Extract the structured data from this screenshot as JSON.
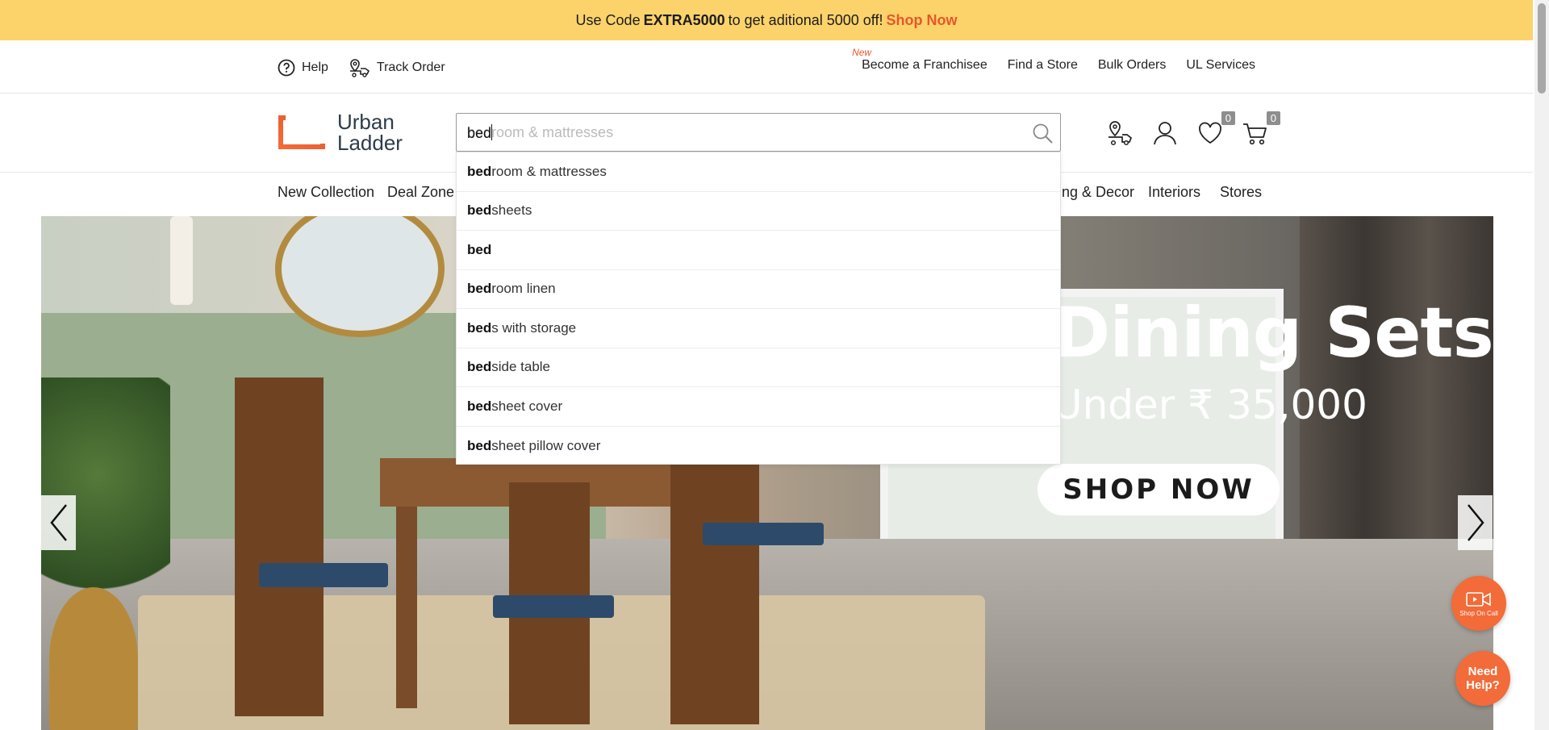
{
  "promo": {
    "prefix": "Use Code",
    "code": "EXTRA5000",
    "suffix": "to get aditional 5000 off!",
    "link": "Shop Now"
  },
  "utility": {
    "help": "Help",
    "track_order": "Track Order",
    "new_tag": "New",
    "links": [
      "Become a Franchisee",
      "Find a Store",
      "Bulk Orders",
      "UL Services"
    ]
  },
  "logo": {
    "line1": "Urban",
    "line2": "Ladder"
  },
  "search": {
    "typed": "bed",
    "ghost": "bedroom & mattresses"
  },
  "header_icons": {
    "wishlist_count": "0",
    "cart_count": "0"
  },
  "nav": {
    "items": [
      "New Collection",
      "Deal Zone",
      "ing & Decor",
      "Interiors",
      "Stores"
    ]
  },
  "suggestions": [
    {
      "match": "bed",
      "rest": "room & mattresses"
    },
    {
      "match": "bed",
      "rest": "sheets"
    },
    {
      "match": "bed",
      "rest": ""
    },
    {
      "match": "bed",
      "rest": "room linen"
    },
    {
      "match": "bed",
      "rest": "s with storage"
    },
    {
      "match": "bed",
      "rest": "side table"
    },
    {
      "match": "bed",
      "rest": "sheet cover"
    },
    {
      "match": "bed",
      "rest": "sheet pillow cover"
    }
  ],
  "hero": {
    "headline": "Dining Sets",
    "subline": "Under ₹ 35,000",
    "button": "SHOP NOW"
  },
  "widgets": {
    "shop_on_call": "Shop On Call",
    "need_help_1": "Need",
    "need_help_2": "Help?"
  },
  "colors": {
    "promo_bg": "#fcd36a",
    "accent": "#e8562b",
    "widget_orange": "#f26b38",
    "logo_text": "#2d3c49"
  }
}
